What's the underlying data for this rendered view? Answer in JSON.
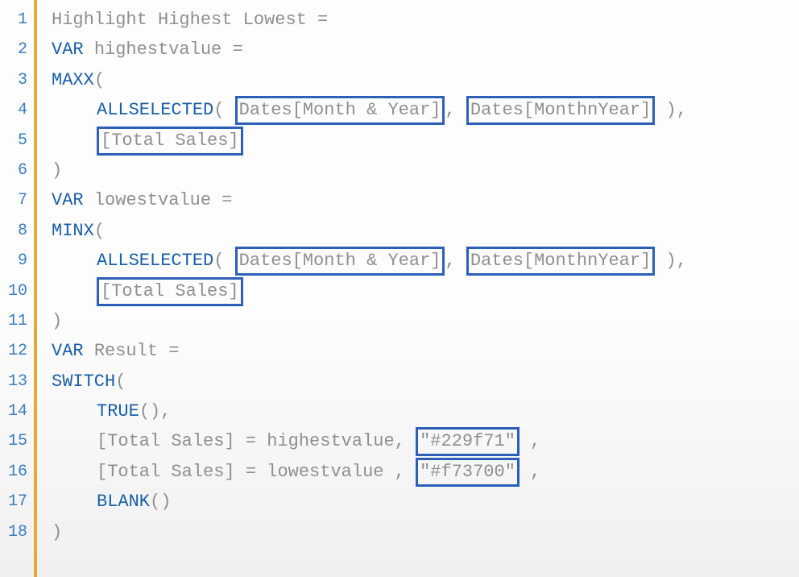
{
  "lineCount": 18,
  "measure": {
    "name": "Highlight Highest Lowest",
    "var1": "highestvalue",
    "var2": "lowestvalue",
    "var3": "Result",
    "aggHigh": "MAXX",
    "aggLow": "MINX",
    "allselected": "ALLSELECTED",
    "col1": "Dates[Month & Year]",
    "col2": "Dates[MonthnYear]",
    "metric": "[Total Sales]",
    "switchFn": "SWITCH",
    "trueFn": "TRUE",
    "blankFn": "BLANK",
    "colorHigh": "\"#229f71\"",
    "colorLow": "\"#f73700\"",
    "varKw": "VAR",
    "eq": " = ",
    "eqShort": " ="
  },
  "glyphs": {
    "open": "(",
    "close": ")",
    "comma": ",",
    "commaSp": ", ",
    "spCommaSp": " , "
  }
}
